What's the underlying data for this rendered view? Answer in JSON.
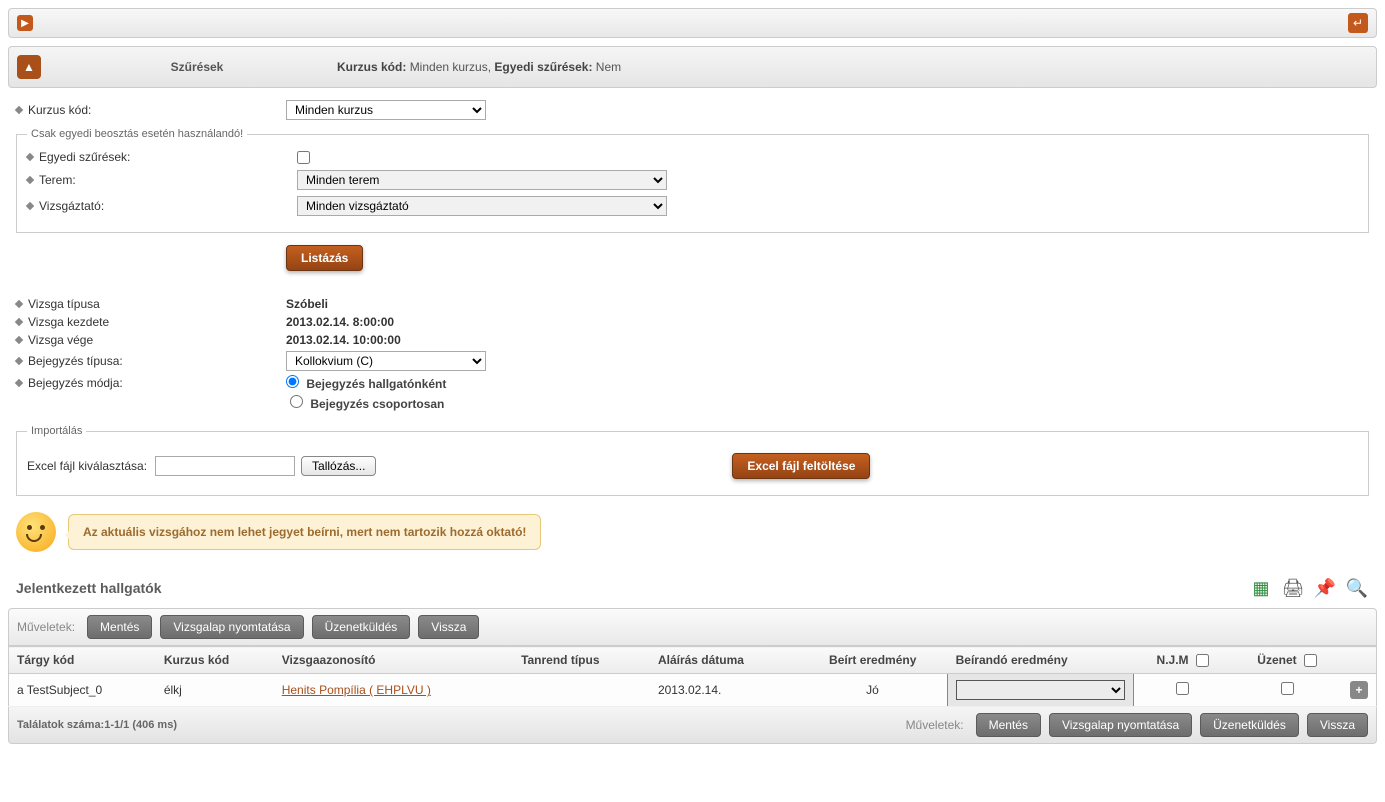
{
  "filters": {
    "title": "Szűrések",
    "summary_label1": "Kurzus kód:",
    "summary_val1": "Minden kurzus,",
    "summary_label2": "Egyedi szűrések:",
    "summary_val2": "Nem",
    "course_code_label": "Kurzus kód:",
    "course_code_value": "Minden kurzus",
    "fieldset_legend": "Csak egyedi beosztás esetén használandó!",
    "custom_filters_label": "Egyedi szűrések:",
    "room_label": "Terem:",
    "room_value": "Minden terem",
    "examiner_label": "Vizsgáztató:",
    "examiner_value": "Minden vizsgáztató",
    "list_button": "Listázás"
  },
  "exam": {
    "type_label": "Vizsga típusa",
    "type_value": "Szóbeli",
    "start_label": "Vizsga kezdete",
    "start_value": "2013.02.14. 8:00:00",
    "end_label": "Vizsga vége",
    "end_value": "2013.02.14. 10:00:00",
    "entry_type_label": "Bejegyzés típusa:",
    "entry_type_value": "Kollokvium (C)",
    "entry_mode_label": "Bejegyzés módja:",
    "mode_per_student": "Bejegyzés hallgatónként",
    "mode_group": "Bejegyzés csoportosan"
  },
  "import": {
    "legend": "Importálás",
    "file_label": "Excel fájl kiválasztása:",
    "browse": "Tallózás...",
    "upload": "Excel fájl feltöltése"
  },
  "message": "Az aktuális vizsgához nem lehet jegyet beírni, mert nem tartozik hozzá oktató!",
  "students": {
    "title": "Jelentkezett hallgatók",
    "actions_label": "Műveletek:",
    "actions": {
      "save": "Mentés",
      "print": "Vizsgalap nyomtatása",
      "message": "Üzenetküldés",
      "back": "Vissza"
    },
    "columns": {
      "subject_code": "Tárgy kód",
      "course_code": "Kurzus kód",
      "exam_id": "Vizsgaazonosító",
      "schedule_type": "Tanrend típus",
      "sign_date": "Aláírás dátuma",
      "entered_result": "Beírt eredmény",
      "result_to_enter": "Beírandó eredmény",
      "njm": "N.J.M",
      "message_col": "Üzenet"
    },
    "rows": [
      {
        "subject_code": "a TestSubject_0",
        "course_code": "élkj",
        "exam_id": "Henits Pompília ( EHPLVU )",
        "schedule_type": "",
        "sign_date": "2013.02.14.",
        "entered_result": "Jó"
      }
    ],
    "footer_left": "Találatok száma:1-1/1 (406 ms)"
  }
}
